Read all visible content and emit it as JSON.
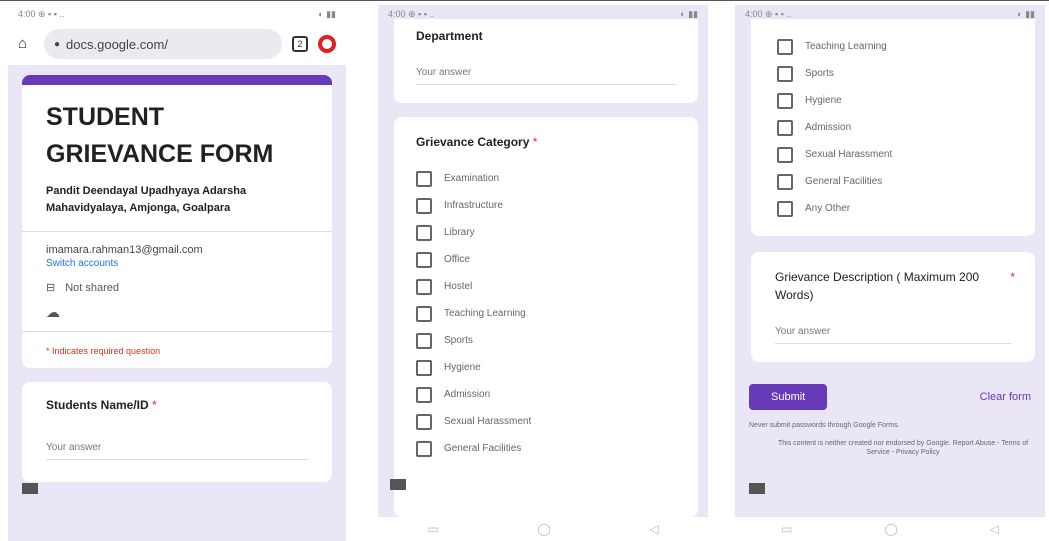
{
  "panel1": {
    "status_left": "4:00 ⊕ ▪ ▪ ..",
    "status_right": "◐ ▮▮",
    "url": "docs.google.com/",
    "tabs_count": "2",
    "form_title": "STUDENT GRIEVANCE FORM",
    "form_subtitle": "Pandit Deendayal Upadhyaya Adarsha Mahavidyalaya, Amjonga, Goalpara",
    "email": "imamara.rahman13@gmail.com",
    "switch_account": "Switch accounts",
    "not_shared": "Not shared",
    "required_note": "* Indicates required question",
    "question_label": "Students Name/ID",
    "question_star": "*",
    "answer_placeholder": "Your answer"
  },
  "panel2": {
    "status_left": "4:00 ⊕ ▪ ▪ ..",
    "status_right": "◐ ▮▮",
    "department_label": "Department",
    "department_placeholder": "Your answer",
    "category_label": "Grievance Category",
    "category_star": "*",
    "options": [
      "Examination",
      "Infrastructure",
      "Library",
      "Office",
      "Hostel",
      "Teaching Learning",
      "Sports",
      "Hygiene",
      "Admission",
      "Sexual Harassment",
      "General Facilities"
    ]
  },
  "panel3": {
    "status_left": "4:00 ⊕ ▪ ▪ ..",
    "status_right": "◐ ▮▮",
    "options": [
      "Teaching Learning",
      "Sports",
      "Hygiene",
      "Admission",
      "Sexual Harassment",
      "General Facilities",
      "Any Other"
    ],
    "description_label": "Grievance Description ( Maximum 200 Words)",
    "description_star": "*",
    "description_placeholder": "Your answer",
    "submit_label": "Submit",
    "clear_label": "Clear form",
    "never_submit": "Never submit passwords through Google Forms.",
    "footer_note": "This content is neither created nor endorsed by Google. Report Abuse - Terms of Service - Privacy Policy"
  },
  "navbar": {
    "recent": "▭",
    "home": "◯",
    "back": "◁"
  }
}
